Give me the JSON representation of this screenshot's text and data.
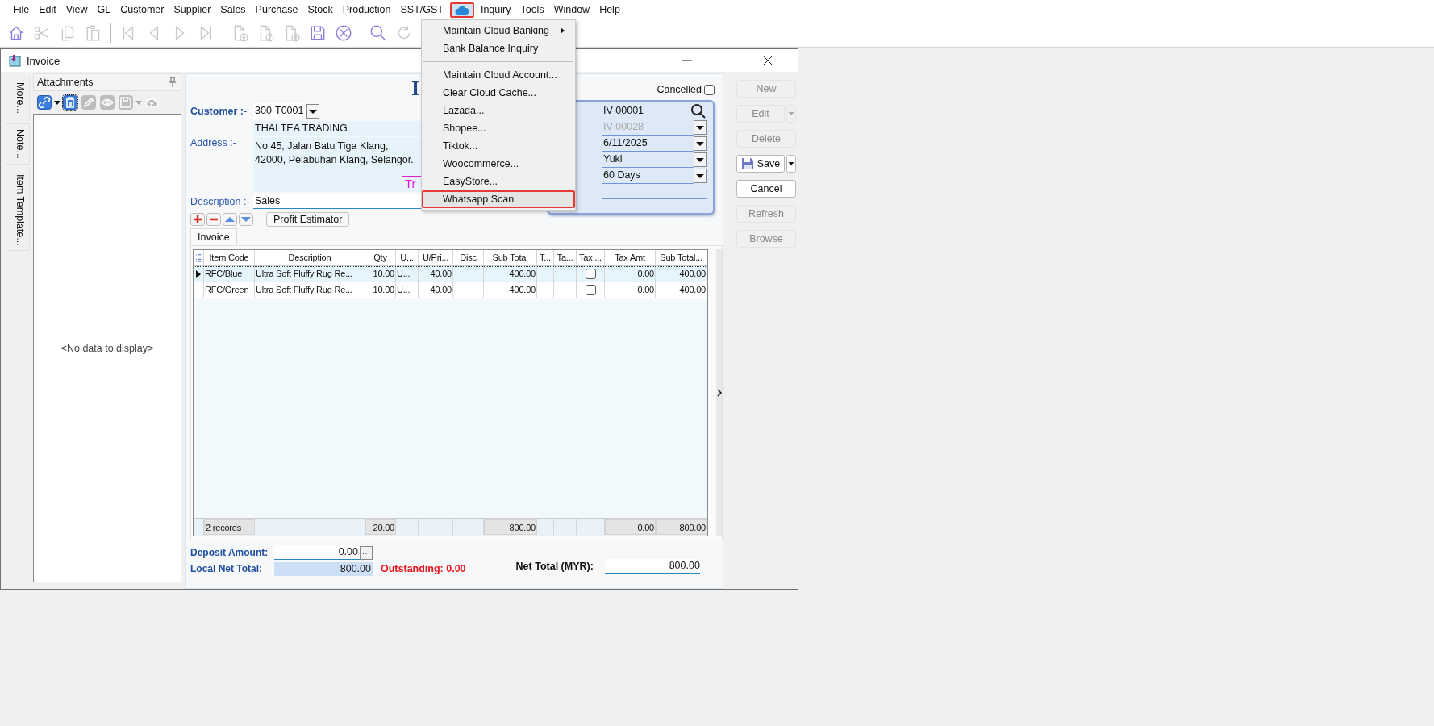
{
  "menu_bar": {
    "items": [
      {
        "kind": "text",
        "label": "File",
        "selected": false,
        "annotated": false
      },
      {
        "kind": "text",
        "label": "Edit",
        "selected": false,
        "annotated": false
      },
      {
        "kind": "text",
        "label": "View",
        "selected": false,
        "annotated": false
      },
      {
        "kind": "text",
        "label": "GL",
        "selected": false,
        "annotated": false
      },
      {
        "kind": "text",
        "label": "Customer",
        "selected": false,
        "annotated": false
      },
      {
        "kind": "text",
        "label": "Supplier",
        "selected": false,
        "annotated": false
      },
      {
        "kind": "text",
        "label": "Sales",
        "selected": false,
        "annotated": false
      },
      {
        "kind": "text",
        "label": "Purchase",
        "selected": false,
        "annotated": false
      },
      {
        "kind": "text",
        "label": "Stock",
        "selected": false,
        "annotated": false
      },
      {
        "kind": "text",
        "label": "Production",
        "selected": false,
        "annotated": false
      },
      {
        "kind": "text",
        "label": "SST/GST",
        "selected": false,
        "annotated": false
      },
      {
        "kind": "cloud",
        "selected": true,
        "annotated": true
      },
      {
        "kind": "text",
        "label": "Inquiry",
        "selected": false,
        "annotated": false
      },
      {
        "kind": "text",
        "label": "Tools",
        "selected": false,
        "annotated": false
      },
      {
        "kind": "text",
        "label": "Window",
        "selected": false,
        "annotated": false
      },
      {
        "kind": "text",
        "label": "Help",
        "selected": false,
        "annotated": false
      }
    ]
  },
  "dropdown": {
    "items": [
      {
        "kind": "item",
        "label": "Maintain Cloud Banking",
        "submenu": true,
        "annotated": false
      },
      {
        "kind": "item",
        "label": "Bank Balance Inquiry",
        "submenu": false,
        "annotated": false
      },
      {
        "kind": "separator"
      },
      {
        "kind": "item",
        "label": "Maintain Cloud Account...",
        "submenu": false,
        "annotated": false
      },
      {
        "kind": "item",
        "label": "Clear Cloud Cache...",
        "submenu": false,
        "annotated": false
      },
      {
        "kind": "item",
        "label": "Lazada...",
        "submenu": false,
        "annotated": false
      },
      {
        "kind": "item",
        "label": "Shopee...",
        "submenu": false,
        "annotated": false
      },
      {
        "kind": "item",
        "label": "Tiktok...",
        "submenu": false,
        "annotated": false
      },
      {
        "kind": "item",
        "label": "Woocommerce...",
        "submenu": false,
        "annotated": false
      },
      {
        "kind": "item",
        "label": "EasyStore...",
        "submenu": false,
        "annotated": false
      },
      {
        "kind": "item",
        "label": "Whatsapp Scan",
        "submenu": false,
        "annotated": true
      }
    ]
  },
  "toolbar": {
    "tools": [
      {
        "kind": "home",
        "disabled": false
      },
      {
        "kind": "scissors",
        "disabled": true
      },
      {
        "kind": "copy",
        "disabled": true
      },
      {
        "kind": "paste",
        "disabled": true
      },
      {
        "kind": "separator"
      },
      {
        "kind": "first",
        "disabled": true
      },
      {
        "kind": "prev",
        "disabled": true
      },
      {
        "kind": "next",
        "disabled": true
      },
      {
        "kind": "last",
        "disabled": true
      },
      {
        "kind": "separator"
      },
      {
        "kind": "doc-new",
        "disabled": true
      },
      {
        "kind": "doc-edit",
        "disabled": true
      },
      {
        "kind": "doc-cancel",
        "disabled": true
      },
      {
        "kind": "save",
        "disabled": false
      },
      {
        "kind": "cancel",
        "disabled": false
      },
      {
        "kind": "separator"
      },
      {
        "kind": "search",
        "disabled": false
      },
      {
        "kind": "refresh",
        "disabled": true
      }
    ]
  },
  "window": {
    "title": "Invoice"
  },
  "side_tabs": [
    "More...",
    "Note...",
    "Item Template..."
  ],
  "attachments": {
    "title": "Attachments",
    "empty_text": "<No data to display>",
    "tools": [
      {
        "kind": "link",
        "disabled": false,
        "focused": false
      },
      {
        "kind": "caret",
        "disabled": false,
        "focused": false
      },
      {
        "kind": "delete",
        "disabled": false,
        "focused": true
      },
      {
        "kind": "edit",
        "disabled": true,
        "focused": false
      },
      {
        "kind": "view",
        "disabled": true,
        "focused": false
      },
      {
        "kind": "save",
        "disabled": true,
        "focused": false
      },
      {
        "kind": "caret",
        "disabled": true,
        "focused": false
      },
      {
        "kind": "upload",
        "disabled": true,
        "focused": false
      }
    ]
  },
  "form": {
    "title": "I",
    "cancelled": {
      "label": "Cancelled",
      "checked": false
    },
    "customer": {
      "label": "Customer :-",
      "code": "300-T0001",
      "name": "THAI TEA TRADING"
    },
    "address": {
      "label": "Address :-",
      "lines": [
        "No 45, Jalan Batu Tiga Klang,",
        "42000, Pelabuhan Klang, Selangor."
      ],
      "tag": "Tr"
    },
    "description": {
      "label": "Description :-",
      "value": "Sales"
    },
    "doc_fields": [
      {
        "kind": "search",
        "value": "IV-00001",
        "disabled": false
      },
      {
        "kind": "combo",
        "value": "IV-00028",
        "disabled": true
      },
      {
        "kind": "combo",
        "value": "6/11/2025",
        "disabled": false
      },
      {
        "kind": "combo",
        "value": "Yuki",
        "disabled": false
      },
      {
        "kind": "combo",
        "value": "60 Days",
        "disabled": false
      },
      {
        "kind": "line"
      },
      {
        "kind": "line"
      }
    ],
    "row_tools": [
      {
        "kind": "add"
      },
      {
        "kind": "remove"
      },
      {
        "kind": "up"
      },
      {
        "kind": "down"
      }
    ],
    "profit_button": "Profit Estimator",
    "tabs": [
      {
        "label": "Invoice",
        "selected": true
      }
    ]
  },
  "grid": {
    "columns": [
      {
        "kind": "text",
        "label": "Item Code",
        "total": "2 records"
      },
      {
        "kind": "text",
        "label": "Description"
      },
      {
        "kind": "number",
        "label": "Qty",
        "total": "20.00"
      },
      {
        "kind": "text",
        "label": "U..."
      },
      {
        "kind": "number",
        "label": "U/Pri..."
      },
      {
        "kind": "number",
        "label": "Disc"
      },
      {
        "kind": "number",
        "label": "Sub Total",
        "total": "800.00"
      },
      {
        "kind": "text",
        "label": "T..."
      },
      {
        "kind": "text",
        "label": "Ta..."
      },
      {
        "kind": "check",
        "label": "Tax ..."
      },
      {
        "kind": "number",
        "label": "Tax Amt",
        "total": "0.00"
      },
      {
        "kind": "number",
        "label": "Sub Total...",
        "total": "800.00"
      }
    ],
    "rows": [
      {
        "selected": true,
        "cells": [
          "RFC/Blue",
          "Ultra Soft Fluffy Rug Re...",
          "10.00",
          "U...",
          "40.00",
          null,
          "400.00",
          null,
          null,
          false,
          "0.00",
          "400.00"
        ]
      },
      {
        "selected": false,
        "cells": [
          "RFC/Green",
          "Ultra Soft Fluffy Rug Re...",
          "10.00",
          "U...",
          "40.00",
          null,
          "400.00",
          null,
          null,
          false,
          "0.00",
          "400.00"
        ]
      }
    ]
  },
  "totals": {
    "deposit": {
      "label": "Deposit Amount:",
      "value": "0.00"
    },
    "local_net_total": {
      "label": "Local Net Total:",
      "value": "800.00"
    },
    "outstanding": "Outstanding: 0.00",
    "net_total": {
      "label": "Net Total (MYR):",
      "value": "800.00"
    }
  },
  "action_buttons": [
    {
      "kind": "plain",
      "label": "New",
      "disabled": true,
      "dropdown": false
    },
    {
      "kind": "plain",
      "label": "Edit",
      "disabled": true,
      "dropdown": true
    },
    {
      "kind": "plain",
      "label": "Delete",
      "disabled": true,
      "dropdown": false
    },
    {
      "kind": "save",
      "label": "Save",
      "disabled": false,
      "dropdown": true
    },
    {
      "kind": "plain",
      "label": "Cancel",
      "disabled": false,
      "dropdown": false
    },
    {
      "kind": "plain",
      "label": "Refresh",
      "disabled": true,
      "dropdown": false
    },
    {
      "kind": "plain",
      "label": "Browse",
      "disabled": true,
      "dropdown": false
    }
  ]
}
